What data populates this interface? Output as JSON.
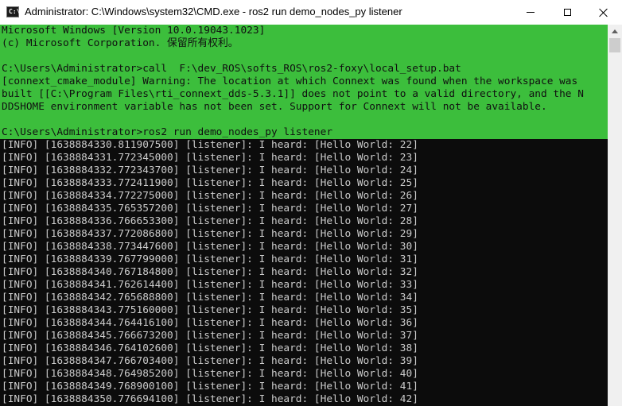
{
  "titlebar": {
    "icon_label": "C:\\",
    "title": "Administrator: C:\\Windows\\system32\\CMD.exe - ros2  run demo_nodes_py listener"
  },
  "console": {
    "header": [
      "Microsoft Windows [Version 10.0.19043.1023]",
      "(c) Microsoft Corporation. 保留所有权利。"
    ],
    "setup_command": "C:\\Users\\Administrator>call  F:\\dev_ROS\\softs_ROS\\ros2-foxy\\local_setup.bat",
    "warning_lines": [
      "[connext_cmake_module] Warning: The location at which Connext was found when the workspace was",
      "built [[C:\\Program Files\\rti_connext_dds-5.3.1]] does not point to a valid directory, and the N",
      "DDSHOME environment variable has not been set. Support for Connext will not be available."
    ],
    "run_command": "C:\\Users\\Administrator>ros2 run demo_nodes_py listener",
    "log_lines": [
      "[INFO] [1638884330.811907500] [listener]: I heard: [Hello World: 22]",
      "[INFO] [1638884331.772345000] [listener]: I heard: [Hello World: 23]",
      "[INFO] [1638884332.772343700] [listener]: I heard: [Hello World: 24]",
      "[INFO] [1638884333.772411900] [listener]: I heard: [Hello World: 25]",
      "[INFO] [1638884334.772275000] [listener]: I heard: [Hello World: 26]",
      "[INFO] [1638884335.765357200] [listener]: I heard: [Hello World: 27]",
      "[INFO] [1638884336.766653300] [listener]: I heard: [Hello World: 28]",
      "[INFO] [1638884337.772086800] [listener]: I heard: [Hello World: 29]",
      "[INFO] [1638884338.773447600] [listener]: I heard: [Hello World: 30]",
      "[INFO] [1638884339.767799000] [listener]: I heard: [Hello World: 31]",
      "[INFO] [1638884340.767184800] [listener]: I heard: [Hello World: 32]",
      "[INFO] [1638884341.762614400] [listener]: I heard: [Hello World: 33]",
      "[INFO] [1638884342.765688800] [listener]: I heard: [Hello World: 34]",
      "[INFO] [1638884343.775160000] [listener]: I heard: [Hello World: 35]",
      "[INFO] [1638884344.764416100] [listener]: I heard: [Hello World: 36]",
      "[INFO] [1638884345.766673200] [listener]: I heard: [Hello World: 37]",
      "[INFO] [1638884346.764102600] [listener]: I heard: [Hello World: 38]",
      "[INFO] [1638884347.766703400] [listener]: I heard: [Hello World: 39]",
      "[INFO] [1638884348.764985200] [listener]: I heard: [Hello World: 40]",
      "[INFO] [1638884349.768900100] [listener]: I heard: [Hello World: 41]",
      "[INFO] [1638884350.776694100] [listener]: I heard: [Hello World: 42]"
    ]
  },
  "icons": {
    "minimize": "minimize-icon",
    "maximize": "maximize-icon",
    "close": "close-icon",
    "scroll_up": "chevron-up-icon"
  },
  "colors": {
    "console_background": "#0c0c0c",
    "console_text": "#cccccc",
    "selection_highlight": "#3cbe3c",
    "titlebar": "#ffffff"
  }
}
